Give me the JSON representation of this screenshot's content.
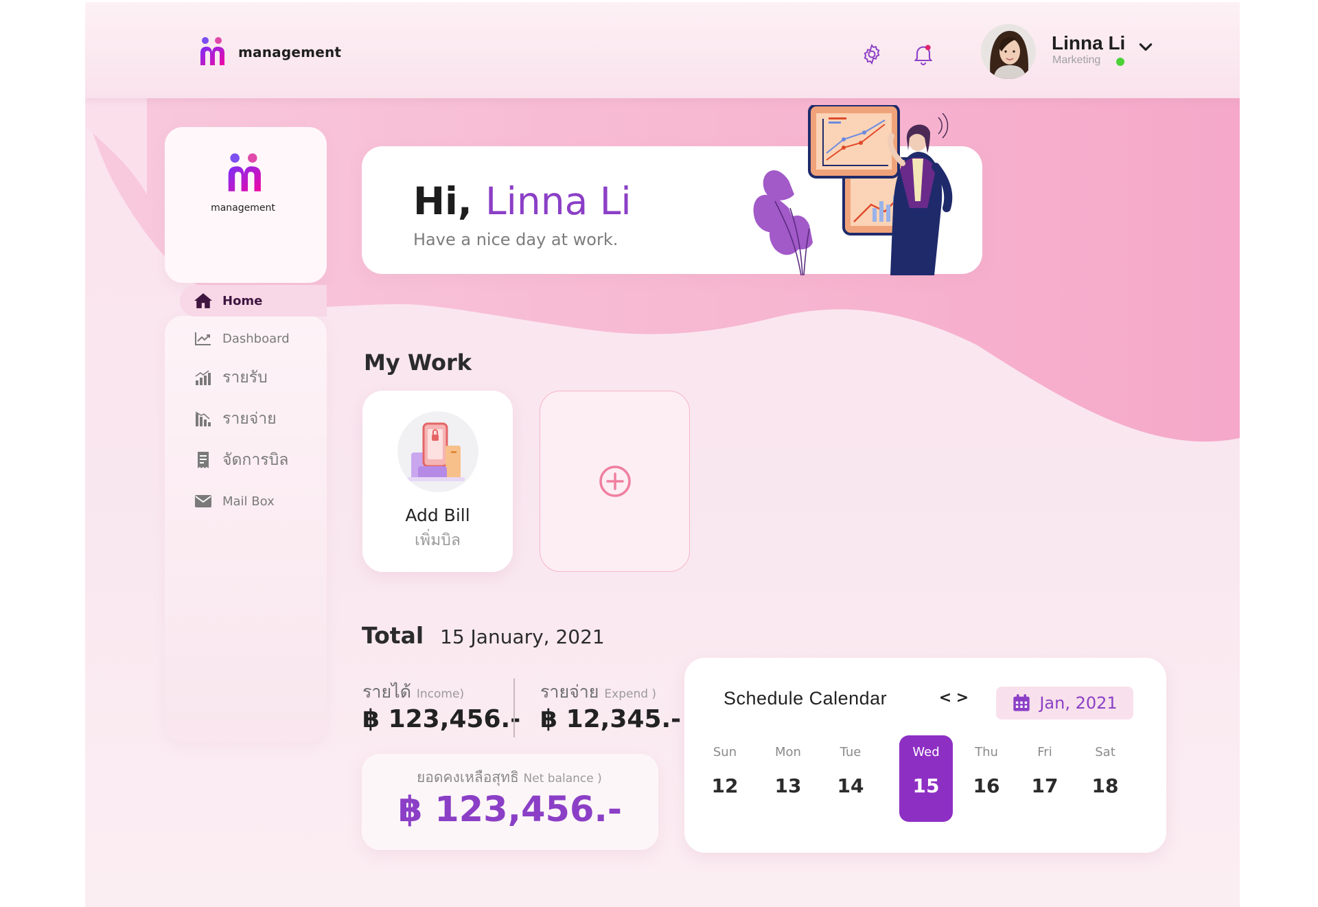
{
  "header": {
    "brand": "management",
    "user_name": "Linna Li",
    "user_role": "Marketing",
    "online_color": "#4cd137"
  },
  "sidebar": {
    "logo_text": "management",
    "items": [
      {
        "label": "Home",
        "icon": "home-icon",
        "active": true
      },
      {
        "label": "Dashboard",
        "icon": "chart-line-icon"
      },
      {
        "label": "รายรับ",
        "icon": "income-chart-icon"
      },
      {
        "label": "รายจ่าย",
        "icon": "expense-chart-icon"
      },
      {
        "label": "จัดการบิล",
        "icon": "receipt-icon"
      },
      {
        "label": "Mail Box",
        "icon": "mail-icon"
      }
    ]
  },
  "hero": {
    "greeting": "Hi,",
    "name": "Linna Li",
    "subtitle": "Have a nice day at work."
  },
  "my_work": {
    "title": "My Work",
    "cards": [
      {
        "title": "Add Bill",
        "subtitle": "เพิ่มบิล",
        "icon": "bill-phone-icon"
      },
      {
        "icon": "plus-circle-icon"
      }
    ]
  },
  "totals": {
    "title": "Total",
    "date": "15 January, 2021",
    "income_label": "รายได้",
    "income_note": "Income)",
    "income_value": "฿ 123,456.-",
    "expense_label": "รายจ่าย",
    "expense_note": "Expend )",
    "expense_value": "฿ 12,345.-",
    "balance_label": "ยอดคงเหลือสุทธิ",
    "balance_note": "Net balance )",
    "balance_value": "฿ 123,456.-"
  },
  "calendar": {
    "title": "Schedule Calendar",
    "prev": "<",
    "next": ">",
    "month": "Jan, 2021",
    "days": [
      {
        "name": "Sun",
        "date": "12"
      },
      {
        "name": "Mon",
        "date": "13"
      },
      {
        "name": "Tue",
        "date": "14"
      },
      {
        "name": "Wed",
        "date": "15",
        "selected": true
      },
      {
        "name": "Thu",
        "date": "16"
      },
      {
        "name": "Fri",
        "date": "17"
      },
      {
        "name": "Sat",
        "date": "18"
      }
    ]
  },
  "colors": {
    "accent": "#8b3fc6",
    "accent_selected": "#8e2fc4",
    "pink": "#f8d7e6"
  }
}
